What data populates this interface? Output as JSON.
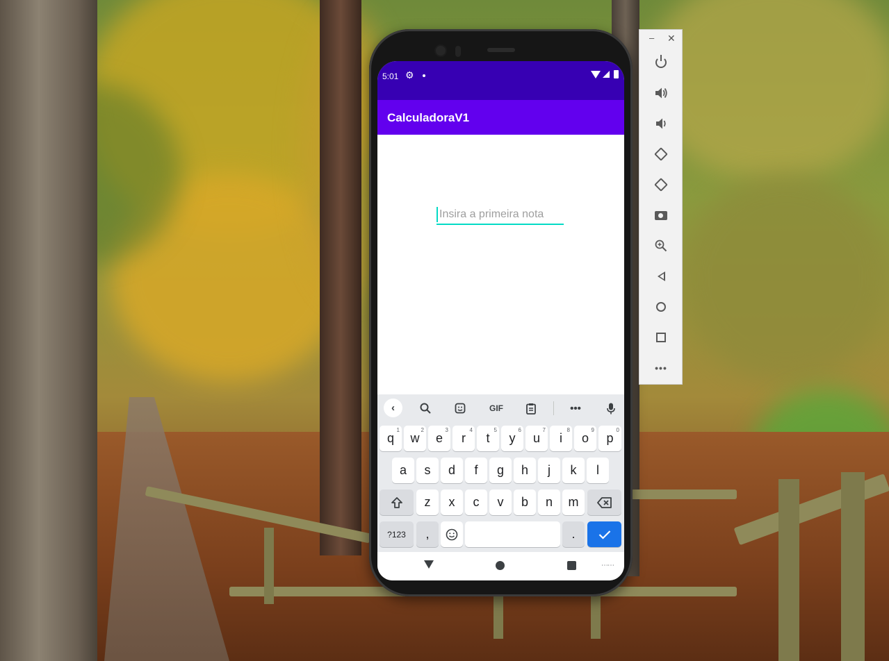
{
  "desktop": {
    "background": "autumn-forest-path-wallpaper"
  },
  "status_bar": {
    "time": "5:01",
    "color": "#3700b3"
  },
  "app_bar": {
    "title": "CalculadoraV1",
    "color": "#6200ee"
  },
  "input": {
    "placeholder": "Insira a primeira nota",
    "value": "",
    "accent": "#03dac5"
  },
  "keyboard": {
    "toolbar": [
      "back-arrow-icon",
      "search-icon",
      "sticker-icon",
      "GIF",
      "clipboard-icon",
      "more-icon",
      "mic-icon"
    ],
    "gif_label": "GIF",
    "row1": [
      {
        "k": "q",
        "h": "1"
      },
      {
        "k": "w",
        "h": "2"
      },
      {
        "k": "e",
        "h": "3"
      },
      {
        "k": "r",
        "h": "4"
      },
      {
        "k": "t",
        "h": "5"
      },
      {
        "k": "y",
        "h": "6"
      },
      {
        "k": "u",
        "h": "7"
      },
      {
        "k": "i",
        "h": "8"
      },
      {
        "k": "o",
        "h": "9"
      },
      {
        "k": "p",
        "h": "0"
      }
    ],
    "row2": [
      "a",
      "s",
      "d",
      "f",
      "g",
      "h",
      "j",
      "k",
      "l"
    ],
    "row3": [
      "z",
      "x",
      "c",
      "v",
      "b",
      "n",
      "m"
    ],
    "symbols_label": "?123",
    "comma_label": ",",
    "period_label": ".",
    "enter_color": "#1a73e8"
  },
  "nav_bar": {
    "buttons": [
      "back",
      "home",
      "recents",
      "keyboard-switch"
    ]
  },
  "emulator_panel": {
    "buttons": [
      "power",
      "volume-up",
      "volume-down",
      "rotate-left",
      "rotate-right",
      "screenshot",
      "zoom",
      "back",
      "home",
      "overview",
      "more"
    ]
  }
}
